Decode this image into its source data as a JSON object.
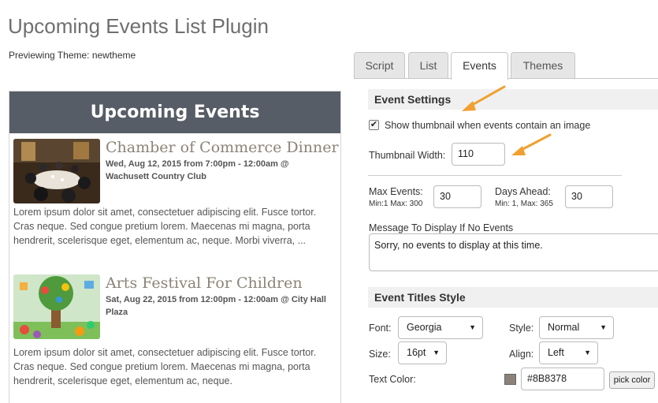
{
  "page": {
    "title": "Upcoming Events List Plugin",
    "theme_note": "Previewing Theme: newtheme"
  },
  "tabs": [
    {
      "label": "Script",
      "active": false
    },
    {
      "label": "List",
      "active": false
    },
    {
      "label": "Events",
      "active": true
    },
    {
      "label": "Themes",
      "active": false
    }
  ],
  "preview": {
    "header": "Upcoming Events",
    "events": [
      {
        "title": "Chamber of Commerce Dinner",
        "meta": "Wed, Aug 12, 2015 from 7:00pm - 12:00am @ Wachusett Country Club",
        "desc": "Lorem ipsum dolor sit amet, consectetuer adipiscing elit. Fusce tortor. Cras neque. Sed congue pretium lorem. Maecenas mi magna, porta hendrerit, scelerisque eget, elementum ac, neque. Morbi viverra, ..."
      },
      {
        "title": "Arts Festival For Children",
        "meta": "Sat, Aug 22, 2015 from 12:00pm - 12:00am @ City Hall Plaza",
        "desc": "Lorem ipsum dolor sit amet, consectetuer adipiscing elit. Fusce tortor. Cras neque. Sed congue pretium lorem. Maecenas mi magna, porta hendrerit, scelerisque eget, elementum ac, neque."
      }
    ]
  },
  "event_settings": {
    "heading": "Event Settings",
    "show_thumbnail_label": "Show thumbnail when events contain an image",
    "show_thumbnail_checked": true,
    "thumbnail_width_label": "Thumbnail Width:",
    "thumbnail_width_value": "110",
    "max_events_label": "Max Events:",
    "max_events_hint": "Min:1 Max: 300",
    "max_events_value": "30",
    "days_ahead_label": "Days Ahead:",
    "days_ahead_hint": "Min: 1, Max: 365",
    "days_ahead_value": "30",
    "no_events_label": "Message To Display If No Events",
    "no_events_value": "Sorry, no events to display at this time."
  },
  "title_style": {
    "heading": "Event Titles Style",
    "font_label": "Font:",
    "font_value": "Georgia",
    "style_label": "Style:",
    "style_value": "Normal",
    "size_label": "Size:",
    "size_value": "16pt",
    "align_label": "Align:",
    "align_value": "Left",
    "color_label": "Text Color:",
    "color_value": "#8B8378",
    "pick_label": "pick color"
  },
  "colors": {
    "header_bg": "#575d66",
    "title_color": "#8b8378",
    "arrow": "#f0a030"
  }
}
